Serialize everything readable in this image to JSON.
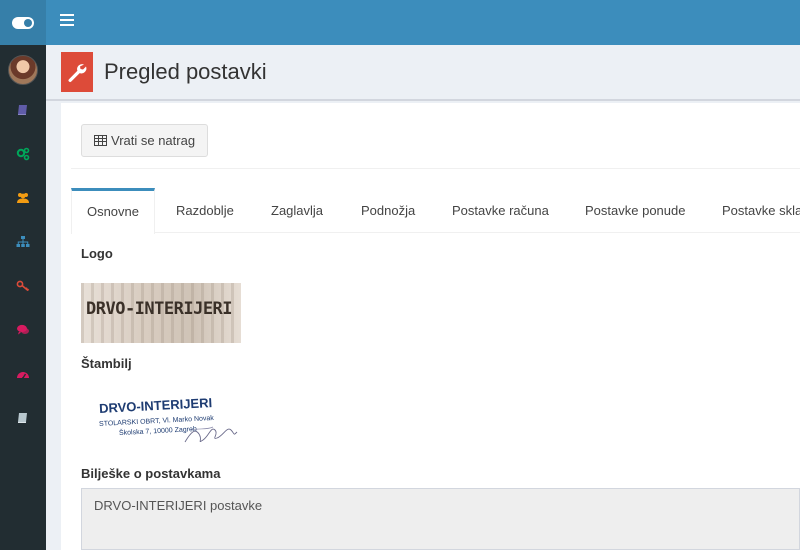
{
  "page": {
    "title": "Pregled postavki"
  },
  "toolbar": {
    "back_label": "Vrati se natrag"
  },
  "tabs": [
    {
      "label": "Osnovne",
      "active": true
    },
    {
      "label": "Razdoblje",
      "active": false
    },
    {
      "label": "Zaglavlja",
      "active": false
    },
    {
      "label": "Podnožja",
      "active": false
    },
    {
      "label": "Postavke računa",
      "active": false
    },
    {
      "label": "Postavke ponude",
      "active": false
    },
    {
      "label": "Postavke skla",
      "active": false
    }
  ],
  "sections": {
    "logo_label": "Logo",
    "stamp_label": "Štambilj",
    "notes_label": "Bilješke o postavkama"
  },
  "images": {
    "logo_text": "DRVO-INTERIJERI",
    "stamp_line1": "DRVO-INTERIJERI",
    "stamp_line2": "STOLARSKI OBRT, Vl. Marko Novak",
    "stamp_line3": "Školska 7, 10000 Zagreb"
  },
  "notes": {
    "value": "DRVO-INTERIJERI postavke"
  },
  "sidebar": {
    "icons": [
      {
        "name": "book-icon",
        "color": "#605ca8"
      },
      {
        "name": "cogs-icon",
        "color": "#00a65a"
      },
      {
        "name": "users-icon",
        "color": "#f39c12"
      },
      {
        "name": "sitemap-icon",
        "color": "#3c8dbc"
      },
      {
        "name": "key-icon",
        "color": "#dd4b39"
      },
      {
        "name": "comments-icon",
        "color": "#d81b60"
      },
      {
        "name": "dashboard-icon",
        "color": "#d81b60"
      },
      {
        "name": "book-icon",
        "color": "#b8c7ce"
      }
    ]
  },
  "colors": {
    "header": "#3c8dbc",
    "sidebar": "#222d32",
    "page_icon": "#dd4b39",
    "active_tab_border": "#3c8dbc"
  }
}
